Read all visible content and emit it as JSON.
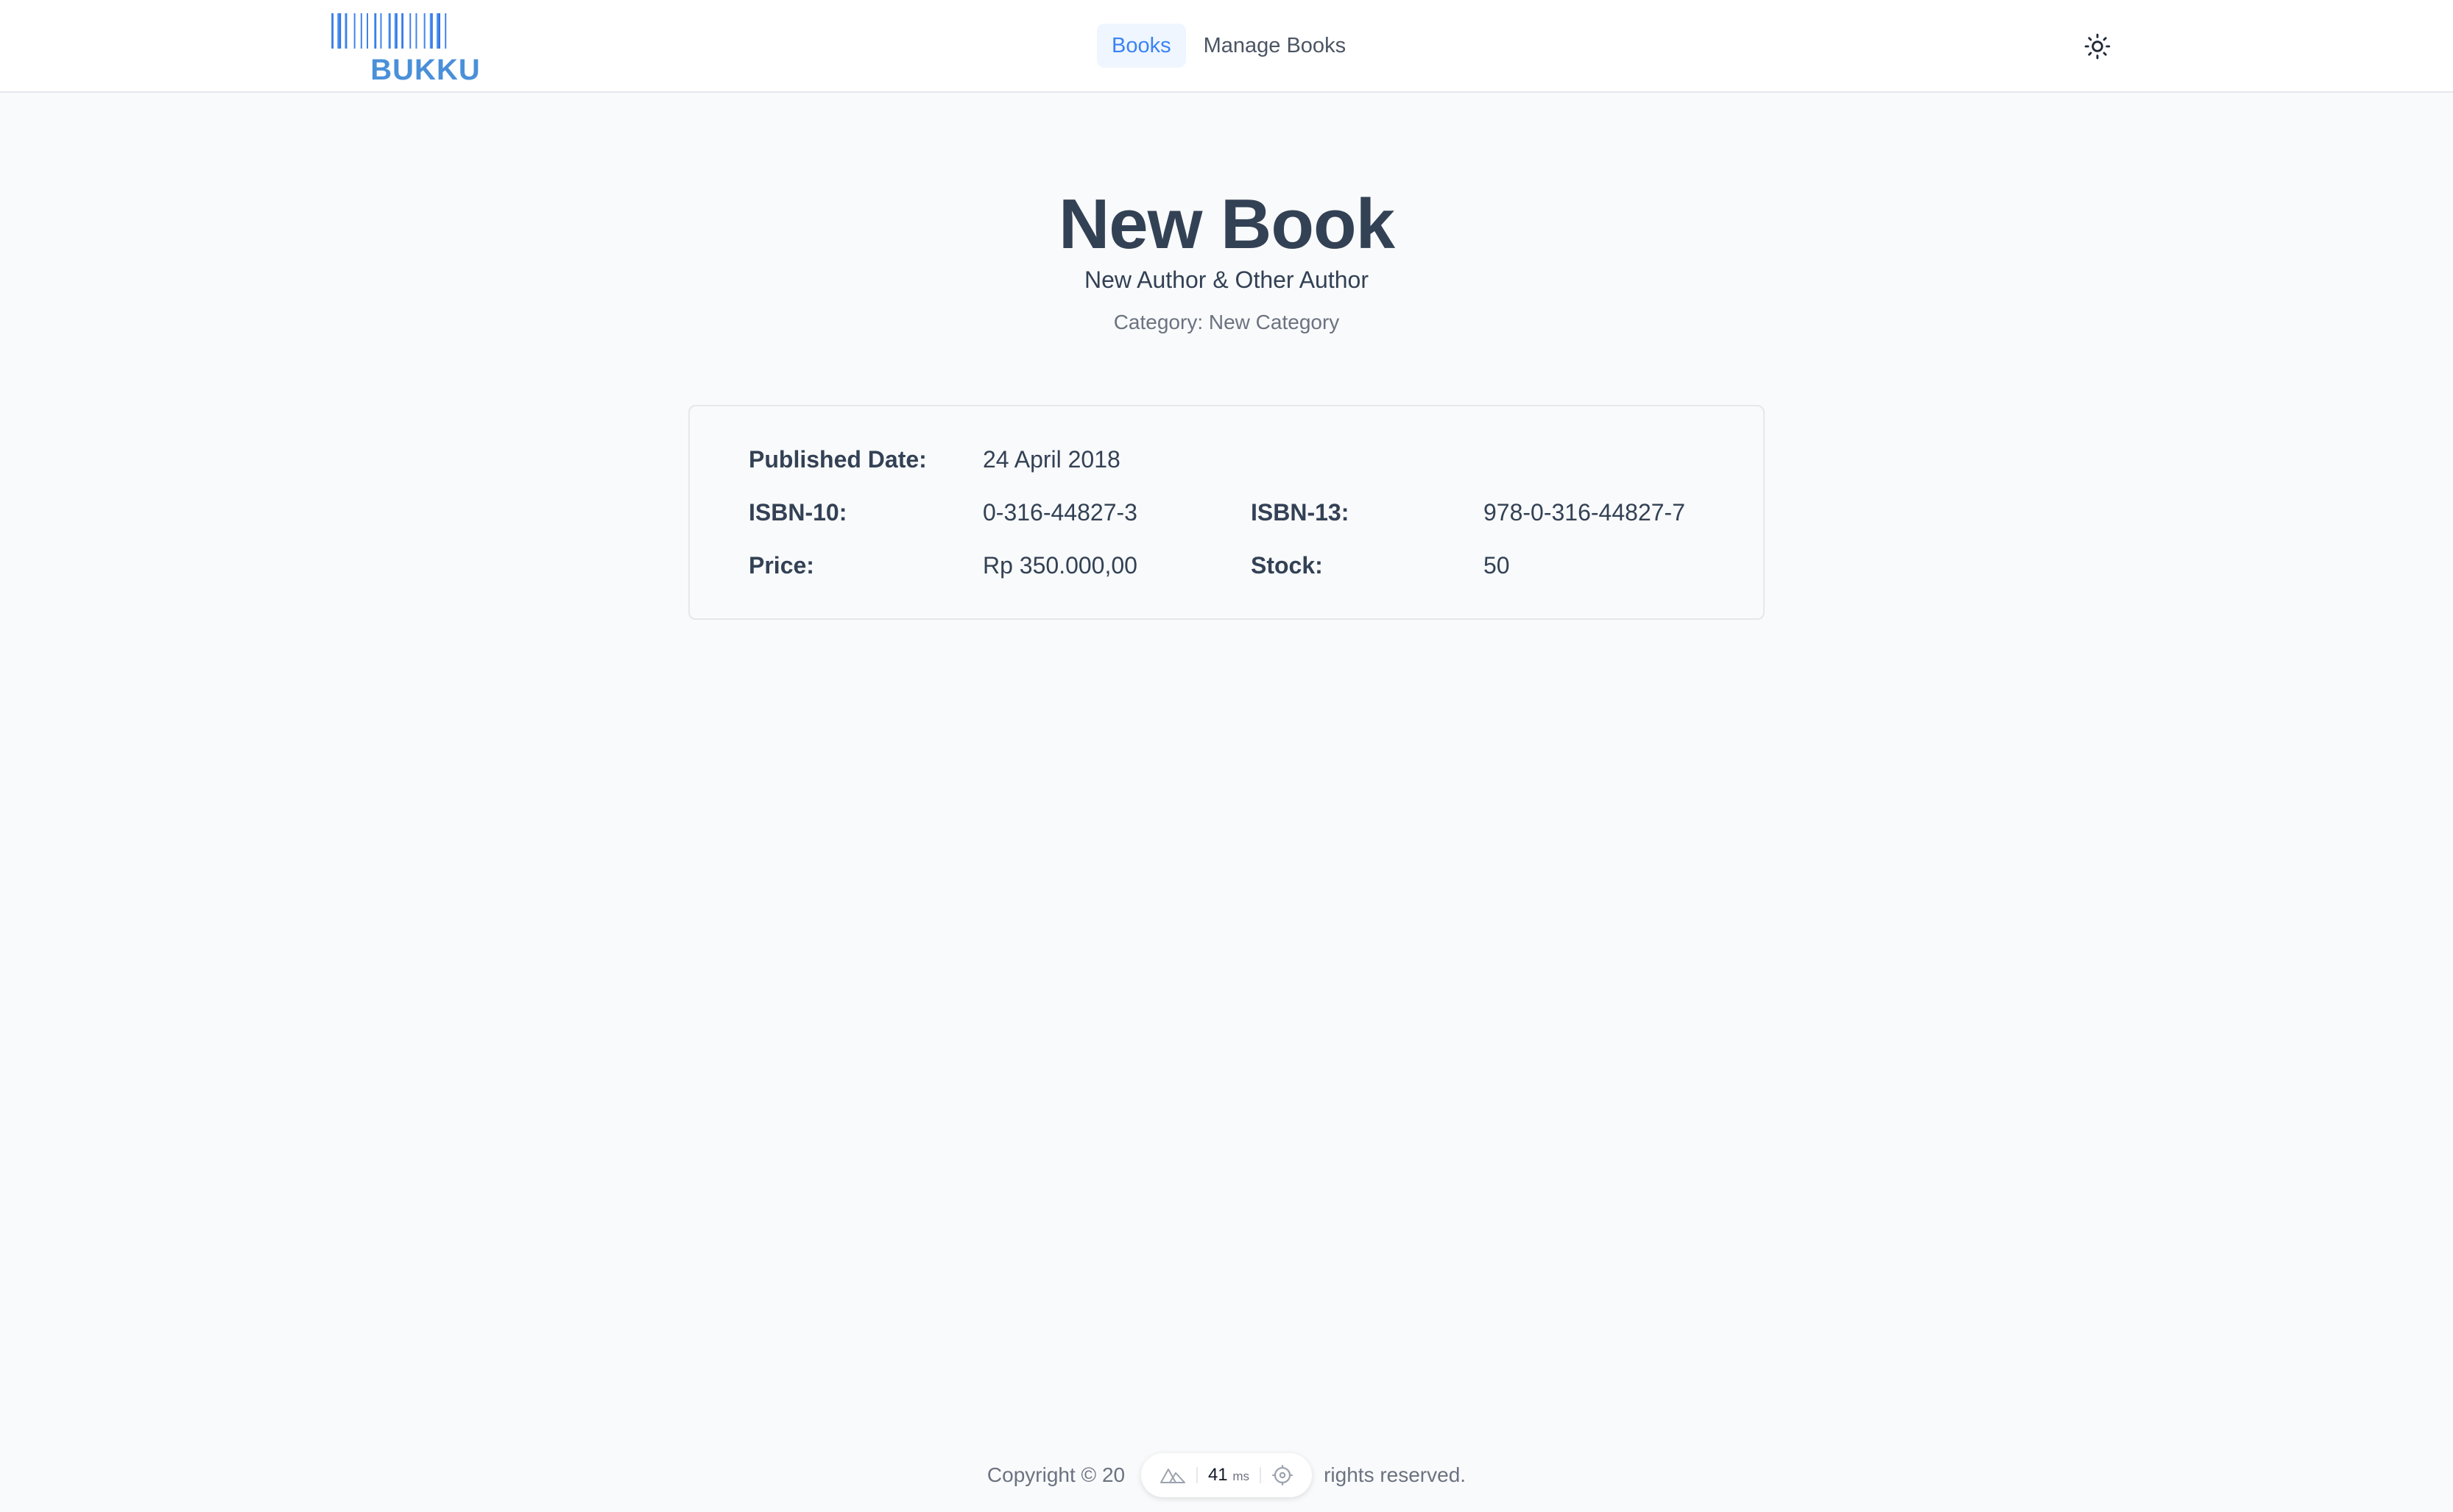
{
  "brand": {
    "name": "BUKKU",
    "color": "#4a90d9"
  },
  "nav": {
    "items": [
      {
        "label": "Books",
        "active": true
      },
      {
        "label": "Manage Books",
        "active": false
      }
    ],
    "theme_toggle_icon": "sun-icon"
  },
  "book": {
    "title": "New Book",
    "authors": "New Author & Other Author",
    "category": "Category: New Category",
    "details": {
      "published_label": "Published Date:",
      "published_value": "24 April 2018",
      "isbn10_label": "ISBN-10:",
      "isbn10_value": "0-316-44827-3",
      "isbn13_label": "ISBN-13:",
      "isbn13_value": "978-0-316-44827-7",
      "price_label": "Price:",
      "price_value": "Rp 350.000,00",
      "stock_label": "Stock:",
      "stock_value": "50"
    }
  },
  "footer": {
    "left_text": "Copyright © 20",
    "right_text": "rights reserved."
  },
  "devbar": {
    "time_value": "41",
    "time_unit": "ms",
    "left_icon": "nuxt-logo-icon",
    "right_icon": "crosshair-icon"
  },
  "colors": {
    "accent": "#3b82f6",
    "heading": "#334155",
    "muted": "#6b7280",
    "background": "#f9fafb"
  }
}
